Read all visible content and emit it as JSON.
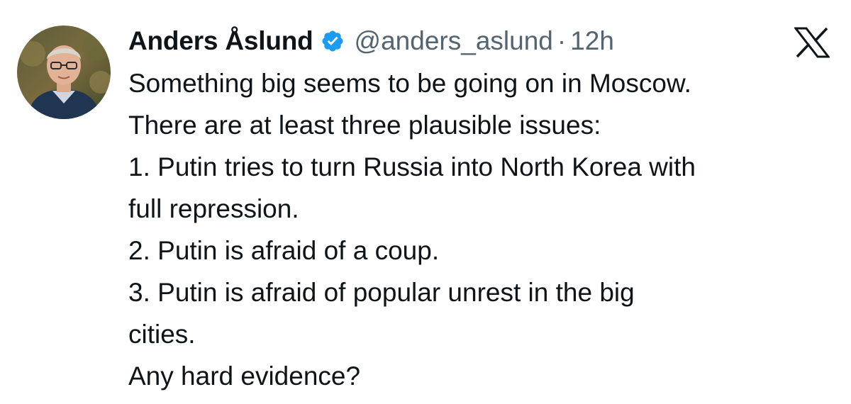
{
  "tweet": {
    "author_name": "Anders Åslund",
    "handle": "@anders_aslund",
    "separator": "·",
    "time": "12h",
    "verified": true,
    "platform_icon": "x-logo-icon",
    "verified_icon": "verified-badge-icon",
    "avatar_icon": "profile-photo",
    "colors": {
      "verified_blue": "#1d9bf0",
      "secondary_text": "#536471",
      "primary_text": "#0f1419"
    },
    "lines": [
      "Something big seems to be going on in Moscow.",
      "There are at least three plausible issues:",
      "1. Putin tries to turn Russia into North Korea with",
      "full repression.",
      "2. Putin is afraid of a coup.",
      "3. Putin is afraid of popular unrest in the big",
      "cities.",
      "Any hard evidence?"
    ]
  }
}
